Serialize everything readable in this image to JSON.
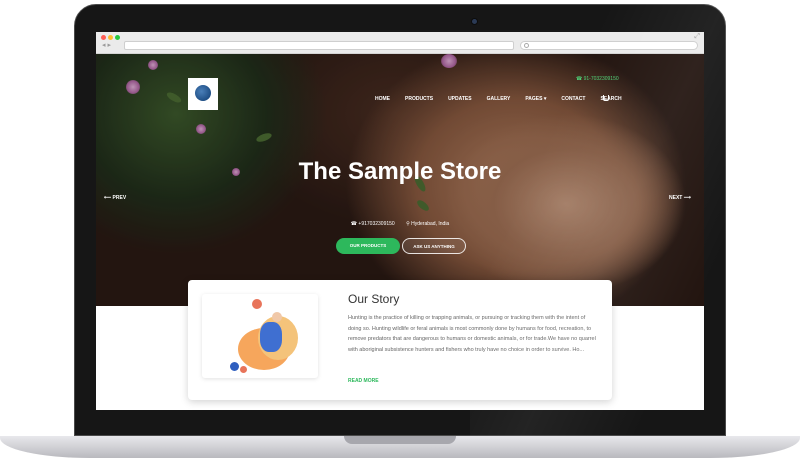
{
  "browser": {
    "address": "",
    "nav_arrows": "◂ ▸"
  },
  "site": {
    "phone_top": "☎ 91-7032309150",
    "menu": [
      "HOME",
      "PRODUCTS",
      "UPDATES",
      "GALLERY",
      "PAGES ▾",
      "CONTACT",
      "SEARCH"
    ],
    "prev_label": "⟵  PREV",
    "next_label": "NEXT  ⟶",
    "hero_title": "The Sample Store",
    "phone": "☎ +917032309150",
    "location": "⚲ Hyderabad, India",
    "btn_products": "OUR PRODUCTS",
    "btn_ask": "ASK US ANYTHING"
  },
  "story": {
    "title": "Our Story",
    "text": "Hunting is the practice of killing or trapping animals, or pursuing or tracking them with the intent of doing so. Hunting wildlife or feral animals is most commonly done by humans for food, recreation, to remove predators that are dangerous to humans or domestic animals, or for trade.We have no quarrel with aboriginal subsistence hunters and fishers who truly have no choice in order to survive. Ho...",
    "read_more": "READ MORE"
  },
  "colors": {
    "accent_green": "#2db85c",
    "phone_green": "#4ed176"
  }
}
